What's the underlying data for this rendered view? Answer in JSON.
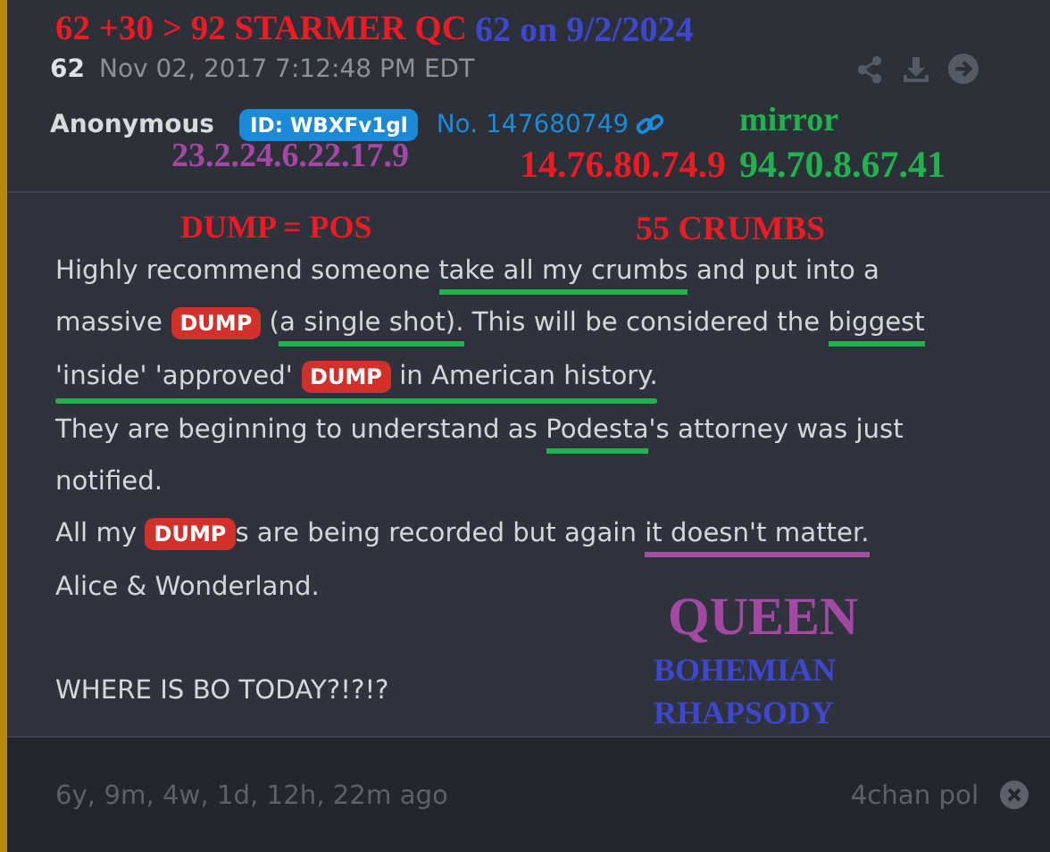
{
  "post": {
    "number": "62",
    "date": "Nov 02, 2017 7:12:48 PM EDT",
    "author": "Anonymous",
    "id_badge": "ID: WBXFv1gl",
    "post_no": "No. 147680749"
  },
  "paragraphs": [
    [
      {
        "segments": [
          {
            "kind": "text",
            "text": "Highly recommend someone "
          },
          {
            "kind": "underlined",
            "text": "take all my crumbs",
            "color": "#22b14c"
          },
          {
            "kind": "text",
            "text": " and put into a"
          }
        ]
      },
      {
        "segments": [
          {
            "kind": "text",
            "text": "massive "
          },
          {
            "kind": "tag",
            "text": "DUMP"
          },
          {
            "kind": "text",
            "text": " ("
          },
          {
            "kind": "underlined",
            "text": "a single shot).",
            "color": "#22b14c"
          },
          {
            "kind": "text",
            "text": " This will be considered the "
          },
          {
            "kind": "underlined",
            "text": "biggest",
            "color": "#22b14c"
          }
        ]
      },
      {
        "color": "#22b14c",
        "segments": [
          {
            "kind": "text",
            "text": "'inside' 'approved' "
          },
          {
            "kind": "tag",
            "text": "DUMP"
          },
          {
            "kind": "text",
            "text": " in American history."
          }
        ]
      },
      {
        "segments": [
          {
            "kind": "text",
            "text": "They are beginning to understand as "
          },
          {
            "kind": "underlined",
            "text": "Podesta",
            "color": "#22b14c"
          },
          {
            "kind": "text",
            "text": "'s attorney was just"
          }
        ]
      },
      {
        "segments": [
          {
            "kind": "text",
            "text": "notified."
          }
        ]
      },
      {
        "segments": [
          {
            "kind": "text",
            "text": "All my "
          },
          {
            "kind": "tag",
            "text": "DUMP"
          },
          {
            "kind": "text",
            "text": "s are being recorded but again "
          },
          {
            "kind": "underlined",
            "text": "it doesn't matter.",
            "color": "#a64ca6"
          }
        ]
      },
      {
        "segments": [
          {
            "kind": "text",
            "text": "Alice & Wonderland."
          }
        ]
      }
    ],
    [
      {
        "segments": [
          {
            "kind": "text",
            "text": "WHERE IS BO TODAY?!?!?"
          }
        ]
      }
    ]
  ],
  "footer": {
    "age": "6y, 9m, 4w, 1d, 12h, 22m ago",
    "source": "4chan pol"
  },
  "annotations": [
    {
      "text": "62 +30 > 92 STARMER QC",
      "color": "#ed1c24"
    },
    {
      "text": "62 on 9/2/2024",
      "color": "#3f48cc"
    },
    {
      "text": "mirror",
      "color": "#22b14c"
    },
    {
      "text": "23.2.24.6.22.17.9",
      "color": "#a349a4"
    },
    {
      "text": "14.76.80.74.9",
      "color": "#ed1c24"
    },
    {
      "text": "94.70.8.67.41",
      "color": "#22b14c"
    },
    {
      "text": "DUMP = POS",
      "color": "#ed1c24"
    },
    {
      "text": "55 CRUMBS",
      "color": "#ed1c24"
    },
    {
      "text": "QUEEN",
      "color": "#a349a4"
    },
    {
      "text": "BOHEMIAN",
      "color": "#3f48cc"
    },
    {
      "text": "RHAPSODY",
      "color": "#3f48cc"
    }
  ]
}
